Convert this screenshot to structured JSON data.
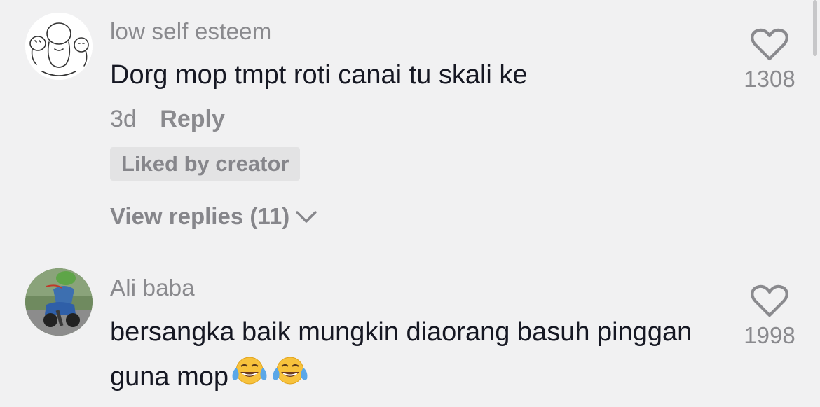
{
  "comments": [
    {
      "username": "low self esteem",
      "text": "Dorg mop tmpt roti canai tu skali ke",
      "time": "3d",
      "reply_label": "Reply",
      "badge": "Liked by creator",
      "view_replies": "View replies (11)",
      "like_count": "1308"
    },
    {
      "username": "Ali baba",
      "text": "bersangka baik mungkin diaorang basuh pinggan guna mop",
      "like_count": "1998",
      "emojis": [
        "face-with-tears-of-joy",
        "face-with-tears-of-joy"
      ]
    }
  ],
  "colors": {
    "background": "#f1f1f2",
    "text_primary": "#161823",
    "text_secondary": "#8a8a8e",
    "badge_bg": "#e3e3e4"
  },
  "icons": {
    "like": "heart-outline-icon",
    "expand": "chevron-down-icon"
  }
}
